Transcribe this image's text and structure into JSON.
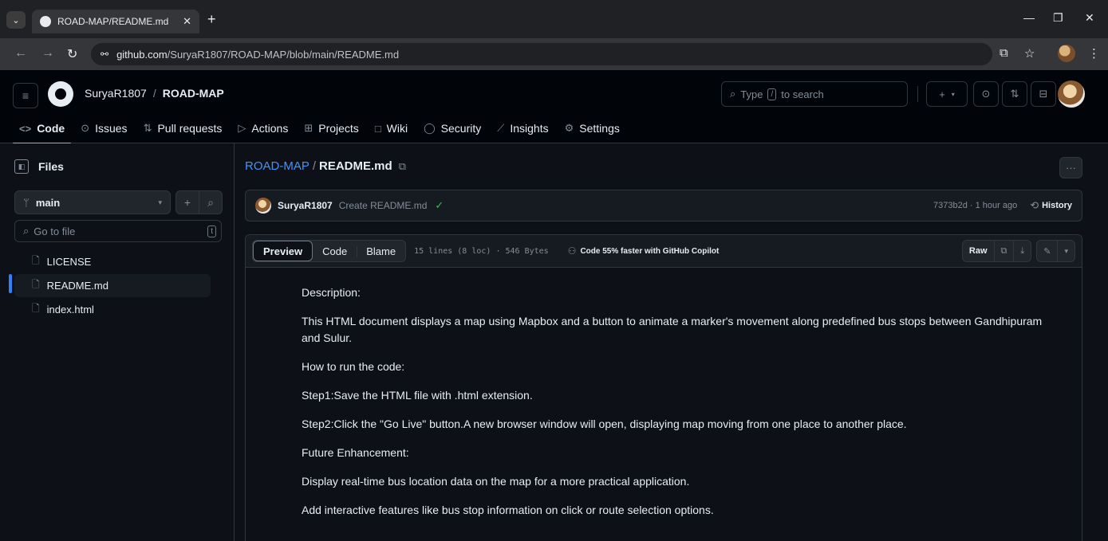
{
  "browser": {
    "tab_title": "ROAD-MAP/README.md at ma",
    "tab_close": "✕",
    "new_tab": "+",
    "url_host": "github.com",
    "url_path": "/SuryaR1807/ROAD-MAP/blob/main/README.md"
  },
  "header": {
    "owner": "SuryaR1807",
    "separator": "/",
    "repo": "ROAD-MAP",
    "search_prefix": "Type",
    "search_key": "/",
    "search_suffix": "to search",
    "create_label": "+"
  },
  "repo_tabs": [
    {
      "label": "Code",
      "icon": "code-icon",
      "glyph": "<>"
    },
    {
      "label": "Issues",
      "icon": "issue-icon",
      "glyph": "⊙"
    },
    {
      "label": "Pull requests",
      "icon": "pull-request-icon",
      "glyph": "⇅"
    },
    {
      "label": "Actions",
      "icon": "play-icon",
      "glyph": "▷"
    },
    {
      "label": "Projects",
      "icon": "table-icon",
      "glyph": "⊞"
    },
    {
      "label": "Wiki",
      "icon": "book-icon",
      "glyph": "□"
    },
    {
      "label": "Security",
      "icon": "shield-icon",
      "glyph": "◯"
    },
    {
      "label": "Insights",
      "icon": "graph-icon",
      "glyph": "⟋"
    },
    {
      "label": "Settings",
      "icon": "gear-icon",
      "glyph": "⚙"
    }
  ],
  "sidebar": {
    "title": "Files",
    "branch": "main",
    "go_to_file": "Go to file",
    "go_to_file_key": "t",
    "files": [
      {
        "name": "LICENSE"
      },
      {
        "name": "README.md"
      },
      {
        "name": "index.html"
      }
    ]
  },
  "breadcrumb": {
    "repo": "ROAD-MAP",
    "slash": "/",
    "file": "README.md"
  },
  "commit": {
    "author": "SuryaR1807",
    "message": "Create README.md",
    "meta": "7373b2d · 1 hour ago",
    "history": "History"
  },
  "file_toolbar": {
    "preview": "Preview",
    "code": "Code",
    "blame": "Blame",
    "stats": "15 lines (8 loc) · 546 Bytes",
    "copilot": "Code 55% faster with GitHub Copilot",
    "raw": "Raw"
  },
  "readme": {
    "paragraphs": [
      "Description:",
      "This HTML document displays a map using Mapbox and a button to animate a marker's movement along predefined bus stops between Gandhipuram and Sulur.",
      "How to run the code:",
      "Step1:Save the HTML file with .html extension.",
      "Step2:Click the \"Go Live\" button.A new browser window will open, displaying map moving from one place to another place.",
      "Future Enhancement:",
      "Display real-time bus location data on the map for a more practical application.",
      "Add interactive features like bus stop information on click or route selection options."
    ]
  },
  "colors": {
    "accent_link": "#4493f8",
    "active_tab_underline": "#fd8c73",
    "success": "#3fb950",
    "background": "#0d1117"
  }
}
